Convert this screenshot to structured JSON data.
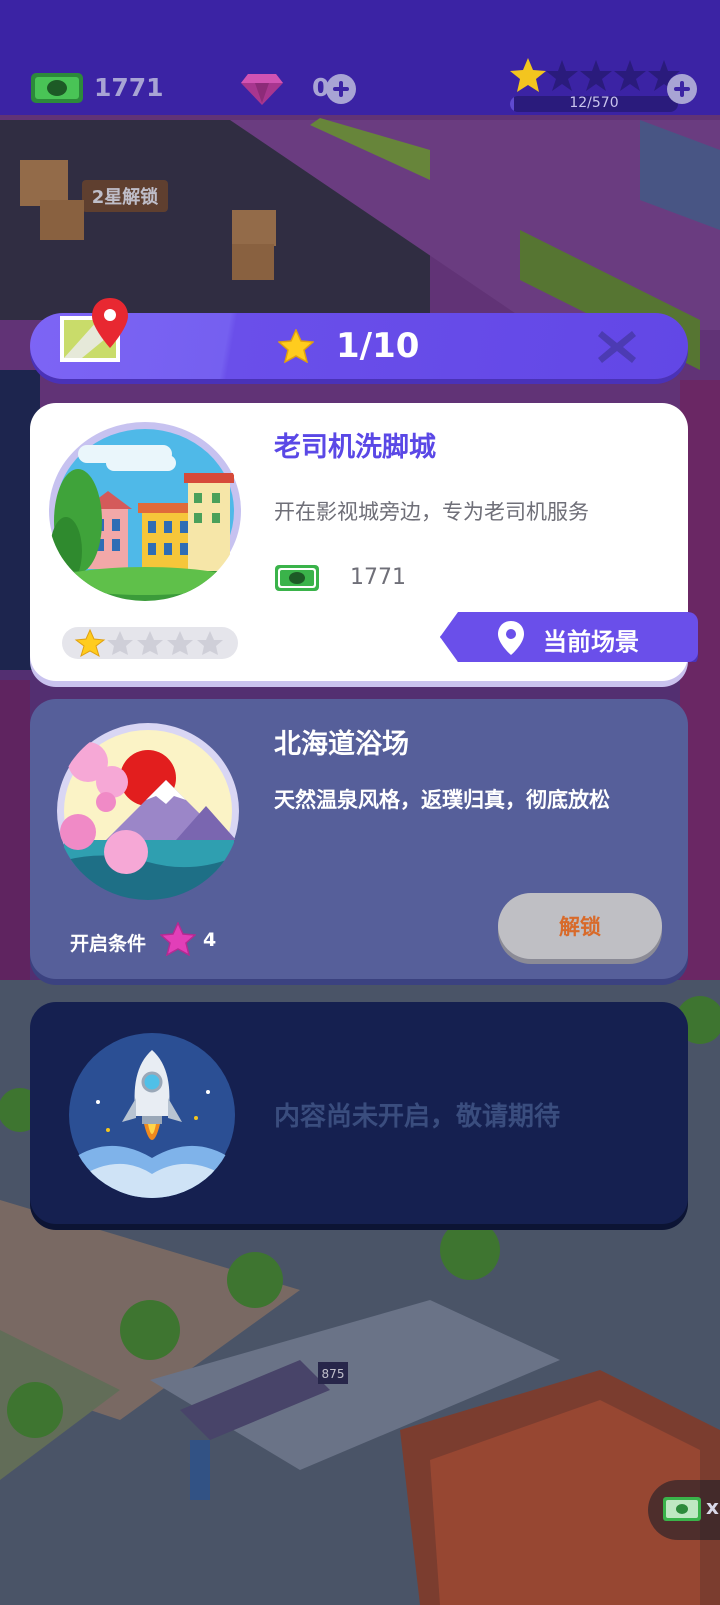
{
  "hud": {
    "cash_value": "1771",
    "gem_value": "0",
    "stars_filled": 1,
    "stars_total": 5,
    "star_progress_text": "12/570",
    "star_progress_fraction": 0.021
  },
  "location_bar": {
    "count": "1/10",
    "icons": [
      "map-icon",
      "star-icon",
      "close-icon"
    ]
  },
  "scenes": {
    "current": {
      "title": "老司机洗脚城",
      "description": "开在影视城旁边，专为老司机服务",
      "cash": "1771",
      "stars_filled": 1,
      "stars_total": 5,
      "badge": "当前场景"
    },
    "locked": {
      "title": "北海道浴场",
      "description": "天然温泉风格，返璞归真，彻底放松",
      "condition_label": "开启条件",
      "condition_value": "4",
      "unlock_label": "解锁"
    },
    "coming_soon": {
      "text": "内容尚未开启，敬请期待"
    }
  },
  "background_labels": {
    "sign": "2星解锁",
    "bus_stop": "875"
  },
  "side_cash": {
    "multiplier": "x"
  },
  "colors": {
    "hud_bg": "#3b23a4",
    "accent": "#6a4fea",
    "current_title": "#5a48e6",
    "locked_card": "#565f9a",
    "soon_card": "#152050",
    "cash_green": "#37b04a",
    "star_gold": "#ffcc1e",
    "gem_pink": "#e23fb8"
  }
}
